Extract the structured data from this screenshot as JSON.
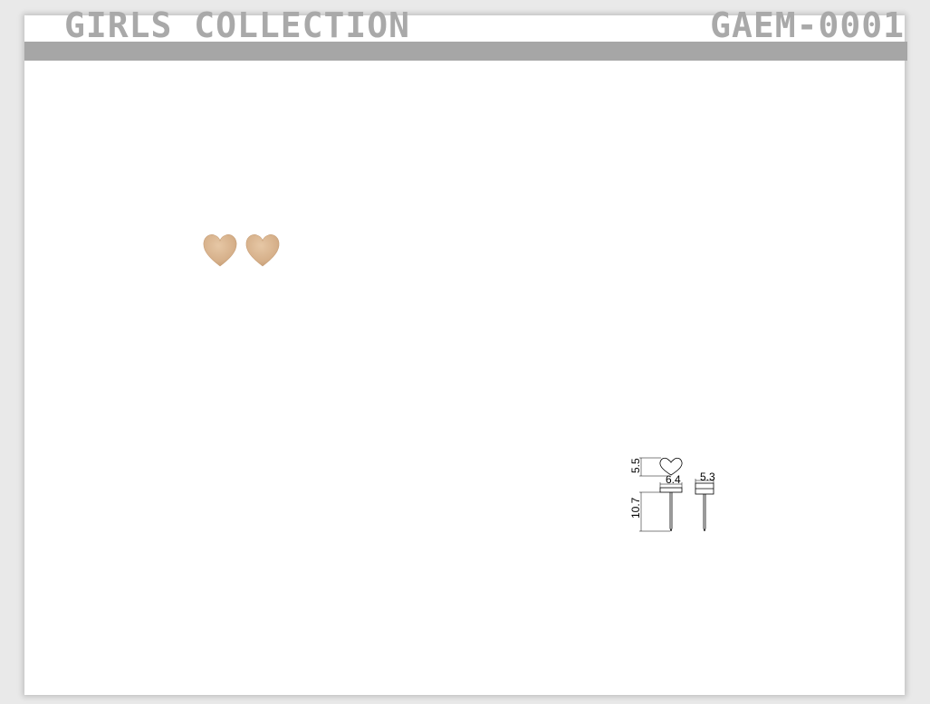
{
  "header": {
    "collection_title": "GIRLS COLLECTION",
    "product_code": "GAEM-0001"
  },
  "product_photo": {
    "subject": "heart stud earrings pair",
    "color": "#d9b48f"
  },
  "technical_drawing": {
    "dimensions": {
      "heart_height": "5.5",
      "heart_width": "6.4",
      "total_length": "10.7",
      "side_depth": "5.3"
    }
  }
}
